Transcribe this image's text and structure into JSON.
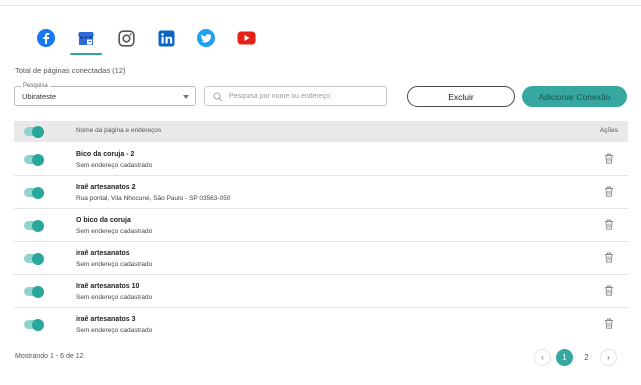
{
  "social_tabs": [
    {
      "name": "facebook-icon",
      "color": "#1877f2"
    },
    {
      "name": "google-my-business-icon",
      "color": "#2d6bd9",
      "active": true
    },
    {
      "name": "instagram-icon",
      "color": "#555555"
    },
    {
      "name": "linkedin-icon",
      "color": "#0a66c2"
    },
    {
      "name": "twitter-icon",
      "color": "#1da1f2"
    },
    {
      "name": "youtube-icon",
      "color": "#e62117"
    }
  ],
  "total_label": "Total de páginas conectadas (12)",
  "filter": {
    "legend": "Pesquisa",
    "value": "Ubirateste"
  },
  "search": {
    "placeholder": "Pesquisa por nome ou endereço"
  },
  "buttons": {
    "delete": "Excluir",
    "add": "Adicionar Conexão"
  },
  "table": {
    "header_name": "Nome da página e endereços",
    "header_actions": "Ações",
    "rows": [
      {
        "name": "Bico da coruja - 2",
        "address": "Sem endereço cadastrado",
        "enabled": true
      },
      {
        "name": "Iraê artesanatos 2",
        "address": "Rua pontal, Vila Nhocuné, São Paulo - SP 03563-050",
        "enabled": true
      },
      {
        "name": "O bico da coruja",
        "address": "Sem endereço cadastrado",
        "enabled": true
      },
      {
        "name": "iraê artesanatos",
        "address": "Sem endereço cadastrado",
        "enabled": true
      },
      {
        "name": "Iraê artesanatos 10",
        "address": "Sem endereço cadastrado",
        "enabled": true
      },
      {
        "name": "iraê artesanatos 3",
        "address": "Sem endereço cadastrado",
        "enabled": true
      }
    ]
  },
  "footer": {
    "showing": "Mostrando 1 - 6 de 12",
    "pages": [
      "1",
      "2"
    ],
    "current_page": "1",
    "prev": "‹",
    "next": "›"
  },
  "colors": {
    "accent": "#36a89f",
    "toggle_on": "#2aa69b"
  }
}
